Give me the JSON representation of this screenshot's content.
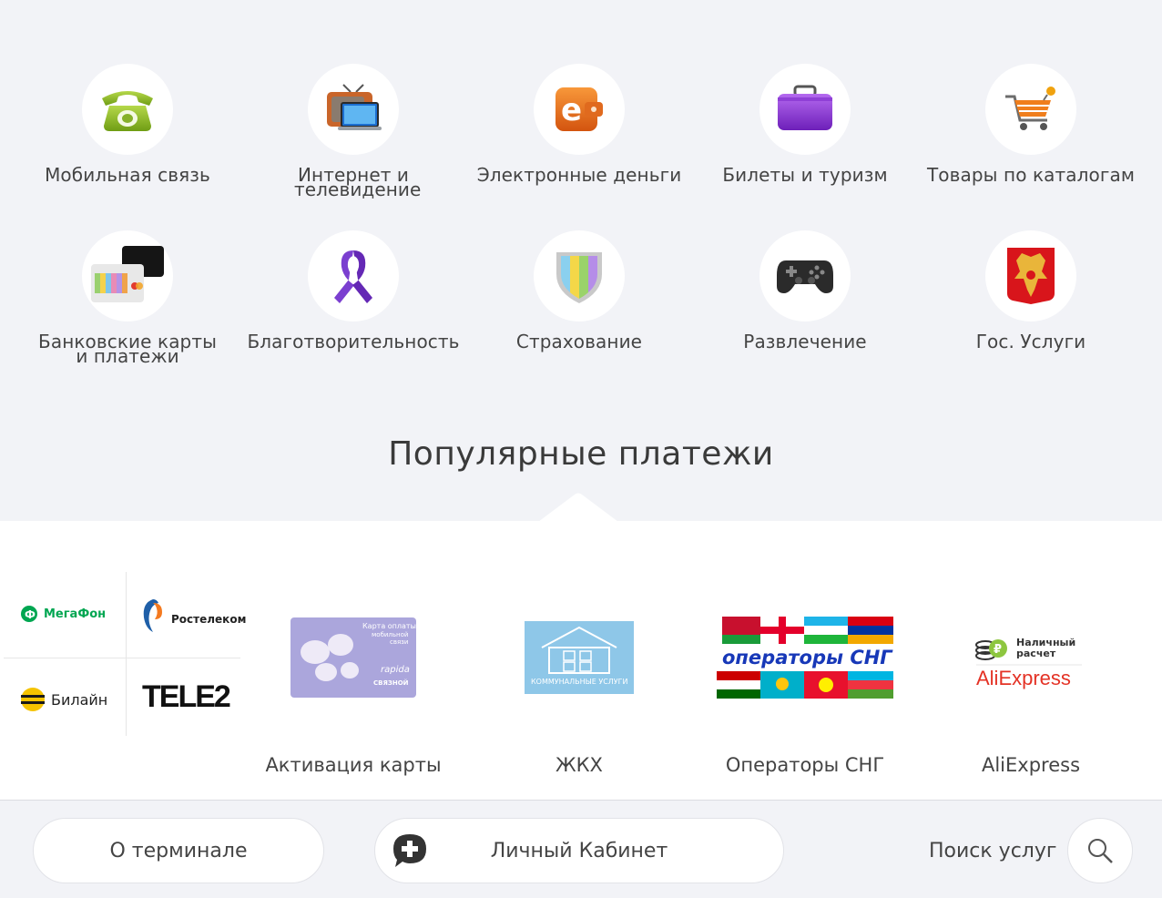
{
  "categories": [
    {
      "label": "Мобильная связь",
      "icon": "telephone-icon"
    },
    {
      "label": "Интернет и телевидение",
      "icon": "tv-icon"
    },
    {
      "label": "Электронные деньги",
      "icon": "e-wallet-icon"
    },
    {
      "label": "Билеты и туризм",
      "icon": "suitcase-icon"
    },
    {
      "label": "Товары по каталогам",
      "icon": "cart-icon"
    },
    {
      "label": "Банковские карты и платежи",
      "icon": "bank-cards-icon"
    },
    {
      "label": "Благотворительность",
      "icon": "ribbon-icon"
    },
    {
      "label": "Страхование",
      "icon": "shield-icon"
    },
    {
      "label": "Развлечение",
      "icon": "gamepad-icon"
    },
    {
      "label": "Гос. Услуги",
      "icon": "coat-of-arms-icon"
    }
  ],
  "popular": {
    "title": "Популярные платежи",
    "operators": {
      "megafon": "МегаФон",
      "rostelecom": "Ростелеком",
      "beeline": "Билайн",
      "tele2": "TELE2"
    },
    "card_image": {
      "line1": "Карта оплаты",
      "line2": "мобильной",
      "line3": "связи",
      "brand1": "rapida",
      "brand2": "СВЯЗНОЙ"
    },
    "zhkh_image_text": "КОММУНАЛЬНЫЕ УСЛУГИ",
    "cis_image_text": "операторы СНГ",
    "ali_image": {
      "cash_line1": "Наличный",
      "cash_line2": "расчет",
      "brand": "AliExpress"
    },
    "items": [
      {
        "label": "Активация карты"
      },
      {
        "label": "ЖКХ"
      },
      {
        "label": "Операторы СНГ"
      },
      {
        "label": "AliExpress"
      }
    ]
  },
  "footer": {
    "about_label": "О терминале",
    "cabinet_label": "Личный Кабинет",
    "search_label": "Поиск услуг"
  },
  "colors": {
    "background": "#f2f3f7",
    "panel": "#ffffff",
    "megafon": "#00a651",
    "beeline": "#f5c300",
    "rostelecom": "#1f5fa8"
  }
}
